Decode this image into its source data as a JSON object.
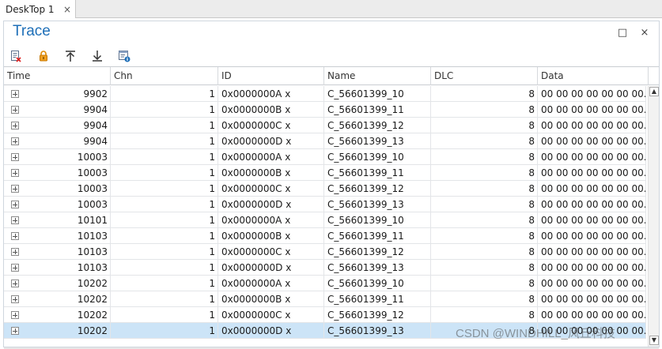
{
  "tab": {
    "label": "DeskTop 1",
    "close_glyph": "×"
  },
  "panel": {
    "title": "Trace",
    "maximize_glyph": "□",
    "close_glyph": "×"
  },
  "toolbar": [
    {
      "icon": "clear-icon"
    },
    {
      "icon": "lock-icon"
    },
    {
      "icon": "scroll-top-icon"
    },
    {
      "icon": "scroll-bottom-icon"
    },
    {
      "icon": "properties-icon"
    }
  ],
  "columns": [
    "Time",
    "Chn",
    "ID",
    "Name",
    "DLC",
    "Data"
  ],
  "rows": [
    {
      "time": "9902",
      "chn": "1",
      "id": "0x0000000A x",
      "name": "C_56601399_10",
      "dlc": "8",
      "data": "00 00 00 00 00 00 00..."
    },
    {
      "time": "9904",
      "chn": "1",
      "id": "0x0000000B x",
      "name": "C_56601399_11",
      "dlc": "8",
      "data": "00 00 00 00 00 00 00..."
    },
    {
      "time": "9904",
      "chn": "1",
      "id": "0x0000000C x",
      "name": "C_56601399_12",
      "dlc": "8",
      "data": "00 00 00 00 00 00 00..."
    },
    {
      "time": "9904",
      "chn": "1",
      "id": "0x0000000D x",
      "name": "C_56601399_13",
      "dlc": "8",
      "data": "00 00 00 00 00 00 00..."
    },
    {
      "time": "10003",
      "chn": "1",
      "id": "0x0000000A x",
      "name": "C_56601399_10",
      "dlc": "8",
      "data": "00 00 00 00 00 00 00..."
    },
    {
      "time": "10003",
      "chn": "1",
      "id": "0x0000000B x",
      "name": "C_56601399_11",
      "dlc": "8",
      "data": "00 00 00 00 00 00 00..."
    },
    {
      "time": "10003",
      "chn": "1",
      "id": "0x0000000C x",
      "name": "C_56601399_12",
      "dlc": "8",
      "data": "00 00 00 00 00 00 00..."
    },
    {
      "time": "10003",
      "chn": "1",
      "id": "0x0000000D x",
      "name": "C_56601399_13",
      "dlc": "8",
      "data": "00 00 00 00 00 00 00..."
    },
    {
      "time": "10101",
      "chn": "1",
      "id": "0x0000000A x",
      "name": "C_56601399_10",
      "dlc": "8",
      "data": "00 00 00 00 00 00 00..."
    },
    {
      "time": "10103",
      "chn": "1",
      "id": "0x0000000B x",
      "name": "C_56601399_11",
      "dlc": "8",
      "data": "00 00 00 00 00 00 00..."
    },
    {
      "time": "10103",
      "chn": "1",
      "id": "0x0000000C x",
      "name": "C_56601399_12",
      "dlc": "8",
      "data": "00 00 00 00 00 00 00..."
    },
    {
      "time": "10103",
      "chn": "1",
      "id": "0x0000000D x",
      "name": "C_56601399_13",
      "dlc": "8",
      "data": "00 00 00 00 00 00 00..."
    },
    {
      "time": "10202",
      "chn": "1",
      "id": "0x0000000A x",
      "name": "C_56601399_10",
      "dlc": "8",
      "data": "00 00 00 00 00 00 00..."
    },
    {
      "time": "10202",
      "chn": "1",
      "id": "0x0000000B x",
      "name": "C_56601399_11",
      "dlc": "8",
      "data": "00 00 00 00 00 00 00..."
    },
    {
      "time": "10202",
      "chn": "1",
      "id": "0x0000000C x",
      "name": "C_56601399_12",
      "dlc": "8",
      "data": "00 00 00 00 00 00 00..."
    },
    {
      "time": "10202",
      "chn": "1",
      "id": "0x0000000D x",
      "name": "C_56601399_13",
      "dlc": "8",
      "data": "00 00 00 00 00 00 00...",
      "selected": true
    }
  ],
  "scrollbar": {
    "up_glyph": "▲",
    "down_glyph": "▼"
  },
  "watermark": "CSDN @WINDHILL_风丘科技"
}
